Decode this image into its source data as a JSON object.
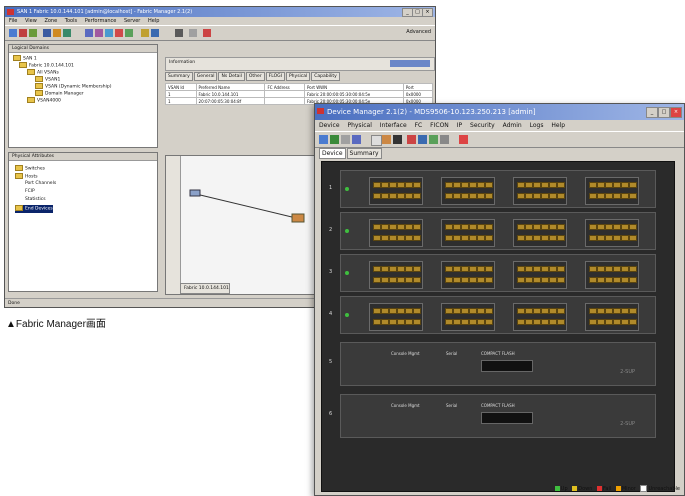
{
  "fabric_manager": {
    "title": "SAN 1 Fabric 10.0.144.101 [admin@localhost] - Fabric Manager 2.1(2)",
    "menu": [
      "File",
      "View",
      "Zone",
      "Tools",
      "Performance",
      "Server",
      "Help"
    ],
    "toolbar_right": "Advanced",
    "logical_pane": {
      "header": "Logical Domains",
      "tree": [
        "SAN 1",
        "Fabric 10.0.144.101",
        "All VSANs",
        "VSAN1",
        "VSAN (Dynamic Membership)",
        "Domain Manager",
        "VSAN4000"
      ]
    },
    "physical_pane": {
      "header": "Physical Attributes",
      "tree": [
        "Switches",
        "Hosts",
        "Port Channels",
        "FCIP",
        "Statistics",
        "End Devices"
      ]
    },
    "summary_button": "Information",
    "tabs": [
      "Summary",
      "General",
      "Ns Detail",
      "Other",
      "FLOGI",
      "Physical",
      "Capability"
    ],
    "table": {
      "headers": [
        "VSAN Id",
        "Preferred Name",
        "FC Address",
        "Port WWN",
        "Port"
      ],
      "rows": [
        [
          "1",
          "Fabric 10.0.144.101",
          "",
          "Fabric 20:00:00:05:30:00:04:5e",
          "0x0000"
        ],
        [
          "1",
          "20:07:00:05:30:04:8f",
          "",
          "Fabric 20:00:00:05:30:00:04:5e",
          "0x0000"
        ]
      ]
    },
    "map_tab": "Fabric 10.0.144.101",
    "status": "Done"
  },
  "caption": "▲Fabric Manager画面",
  "device_manager": {
    "title": "Device Manager 2.1(2) - MDS9506-10.123.250.213 [admin]",
    "menu": [
      "Device",
      "Physical",
      "Interface",
      "FC",
      "FICON",
      "IP",
      "Security",
      "Admin",
      "Logs",
      "Help"
    ],
    "tabs": [
      "Device",
      "Summary"
    ],
    "slots": [
      "1",
      "2",
      "3",
      "4",
      "5",
      "6"
    ],
    "supervisor_labels": [
      "Console Mgmt",
      "Serial",
      "COMPACT FLASH"
    ],
    "module_model": "2-SUP",
    "legend": [
      "Up",
      "Down",
      "Fail",
      "Minor",
      "Unreachable"
    ],
    "legend_colors": [
      "#3fbf3f",
      "#e0c020",
      "#e03030",
      "#f0a000",
      "#ffffff"
    ]
  }
}
